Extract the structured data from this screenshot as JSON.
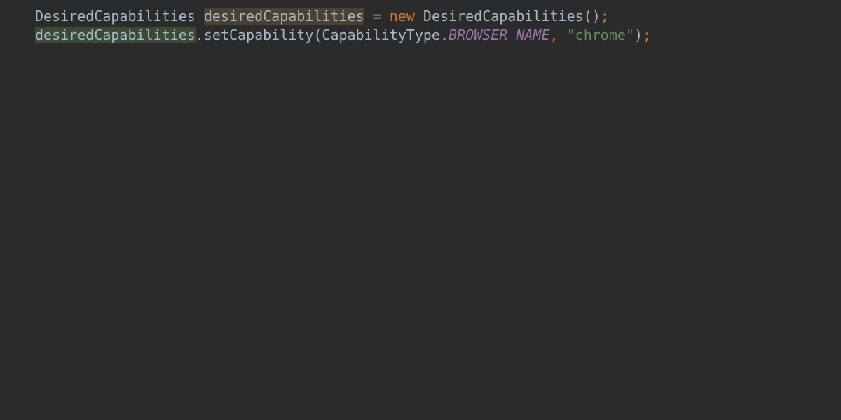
{
  "colors": {
    "background": "#2b2b2b",
    "default": "#a9b7c6",
    "keyword": "#cc7832",
    "constant": "#9876aa",
    "string": "#6a8759",
    "punct": "#cc7832",
    "highlight_brown": "#4a4130",
    "highlight_green": "#3a4a33"
  },
  "code": {
    "line1": {
      "t0": "DesiredCapabilities ",
      "t1": "desiredCapabilities",
      "t2": " = ",
      "t3": "new",
      "t4": " DesiredCapabilities()",
      "t5": ";"
    },
    "line2": {
      "t0": "desiredCapabilities",
      "t1": ".setCapability(CapabilityType.",
      "t2": "BROWSER_NAME",
      "t3": ", ",
      "t4": "\"chrome\"",
      "t5": ")",
      "t6": ";"
    }
  }
}
